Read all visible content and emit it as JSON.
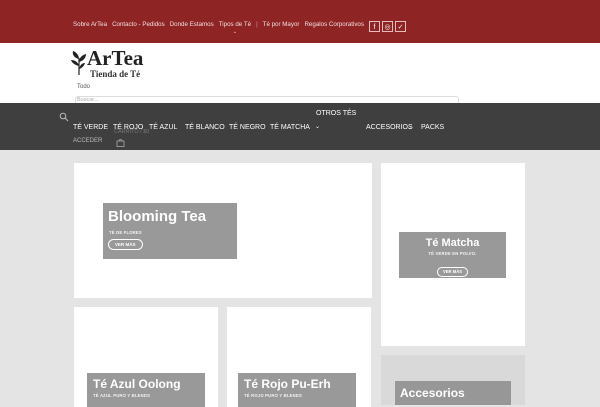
{
  "topbar": {
    "links": [
      {
        "label": "Sobre ArTea"
      },
      {
        "label": "Contacto - Pedidos"
      },
      {
        "label": "Donde Estamos"
      },
      {
        "label": "Tipos de Té"
      },
      {
        "label": "Té por Mayor"
      },
      {
        "label": "Regalos Corporativos"
      }
    ],
    "separator": "|",
    "dropdown_chevron": "⌄",
    "social": [
      {
        "icon": "facebook-icon",
        "glyph": "f"
      },
      {
        "icon": "instagram-icon",
        "glyph": "◎"
      },
      {
        "icon": "twitter-icon",
        "glyph": "✓"
      }
    ],
    "color": "#8e2424"
  },
  "header": {
    "brand": "ArTea",
    "tagline": "Tienda de Té",
    "category_select": "Todo",
    "search_placeholder": "Buscar..."
  },
  "nav": {
    "items": [
      {
        "label": "TÉ VERDE"
      },
      {
        "label": "TÉ ROJO"
      },
      {
        "label": "TÉ AZUL"
      },
      {
        "label": "TÉ BLANCO"
      },
      {
        "label": "TÉ NEGRO"
      },
      {
        "label": "TÉ MATCHA"
      },
      {
        "label": "OTROS TÉS"
      },
      {
        "label": "ACCESORIOS"
      },
      {
        "label": "PACKS"
      }
    ],
    "dropdown_chevron": "⌄",
    "accesorios_chevron": "⌄",
    "account": "ACCEDER",
    "cart_text": "CARRITO / $0",
    "color": "#3f3f3f"
  },
  "cards": [
    {
      "title": "Blooming Tea",
      "subtitle": "TÉ DE FLORES",
      "button": "VER MÁS"
    },
    {
      "title": "Té Matcha",
      "subtitle": "TÉ VERDE EN POLVO.",
      "button": "VER MÁS"
    },
    {
      "title": "Té Azul Oolong",
      "subtitle": "TÉ AZUL PURO Y BLENDS"
    },
    {
      "title": "Té Rojo Pu-Erh",
      "subtitle": "TÉ ROJO PURO Y BLENDS"
    },
    {
      "title": "Accesorios"
    }
  ]
}
